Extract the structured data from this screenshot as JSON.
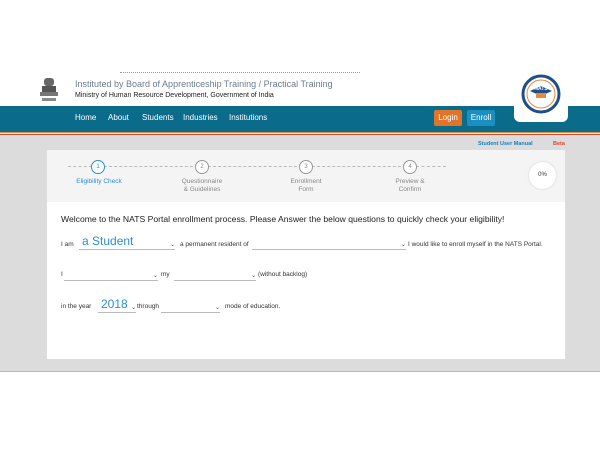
{
  "header": {
    "institution": "Instituted by Board of Apprenticeship Training / Practical Training",
    "ministry": "Ministry of Human Resource Development, Government of India",
    "logo_text": "NATS"
  },
  "nav": {
    "items": [
      "Home",
      "About",
      "Students",
      "Industries",
      "Institutions"
    ],
    "login": "Login",
    "enroll": "Enroll"
  },
  "links": {
    "manual": "Student User Manual",
    "beta": "Beta"
  },
  "stepper": {
    "steps": [
      {
        "num": "1",
        "label1": "Eligibility Check",
        "label2": ""
      },
      {
        "num": "2",
        "label1": "Questionnaire",
        "label2": "& Guidelines"
      },
      {
        "num": "3",
        "label1": "Enrollment",
        "label2": "Form"
      },
      {
        "num": "4",
        "label1": "Preview &",
        "label2": "Confirm"
      }
    ],
    "progress": "0%"
  },
  "form": {
    "welcome": "Welcome to the NATS Portal enrollment process. Please Answer the below questions to quickly check your eligibility!",
    "i_am": "I am",
    "student_value": "a Student",
    "resident_text": "a permanent resident of",
    "resident_value": "",
    "enroll_text": "I would like to enroll myself in the NATS Portal.",
    "i_label": "I",
    "completed_value": "",
    "my_label": "my",
    "course_value": "",
    "backlog_text": "(without backlog)",
    "year_text": "in the year",
    "year_value": "2018",
    "through_text": "through",
    "mode_value": "",
    "mode_text": "mode of education."
  },
  "colors": {
    "nav_bg": "#0a6b8a",
    "login_bg": "#e0752a",
    "enroll_bg": "#1c8fc2",
    "accent": "#2a8fd0"
  }
}
